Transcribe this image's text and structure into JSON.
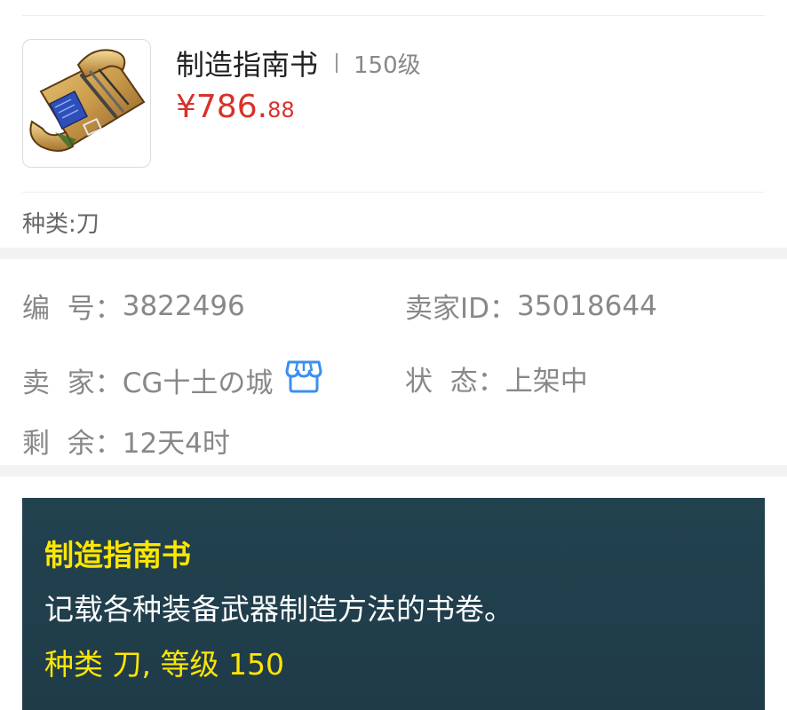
{
  "item": {
    "name": "制造指南书",
    "level": "150级",
    "price_main": "¥786.",
    "price_cents": "88",
    "category": "种类:刀",
    "image_icon": "scroll-icon"
  },
  "details": {
    "id_label": "编  号：",
    "id_value": "3822496",
    "seller_id_label": "卖家ID：",
    "seller_id_value": "35018644",
    "seller_label": "卖  家：",
    "seller_value": "CG十土の城",
    "seller_icon": "shop-icon",
    "status_label": "状  态：",
    "status_value": "上架中",
    "remaining_label": "剩  余：",
    "remaining_value": "12天4时"
  },
  "description": {
    "title": "制造指南书",
    "text": "记载各种装备武器制造方法的书卷。",
    "meta": "种类 刀, 等级 150"
  },
  "colors": {
    "price": "#d8312b",
    "desc_bg": "#22424f",
    "desc_highlight": "#ffe600",
    "shop_icon": "#3b8ff0"
  }
}
